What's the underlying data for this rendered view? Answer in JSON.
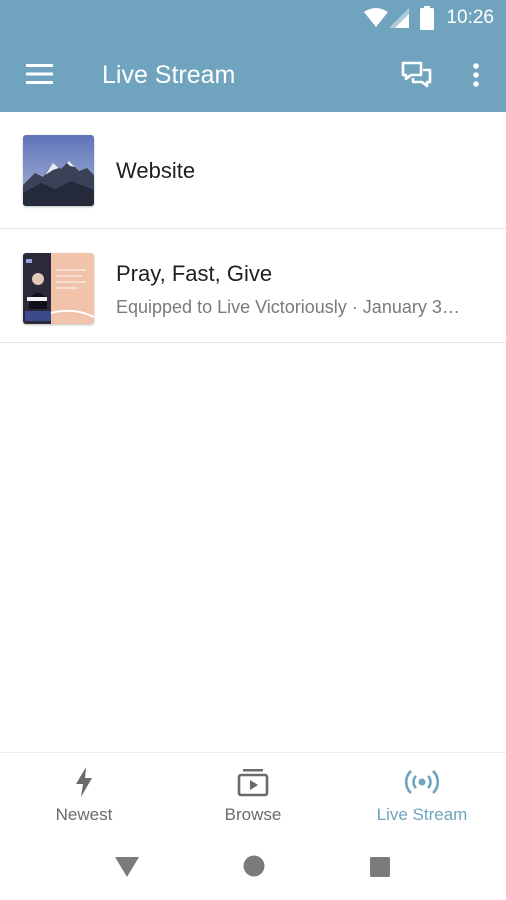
{
  "status_bar": {
    "time": "10:26"
  },
  "toolbar": {
    "title": "Live Stream"
  },
  "items": [
    {
      "title": "Website",
      "subtitle": ""
    },
    {
      "title": "Pray, Fast, Give",
      "subtitle": "Equipped to Live Victoriously · January 3…"
    }
  ],
  "bottom_nav": [
    {
      "label": "Newest",
      "icon": "bolt-icon",
      "active": false
    },
    {
      "label": "Browse",
      "icon": "video-library-icon",
      "active": false
    },
    {
      "label": "Live Stream",
      "icon": "broadcast-icon",
      "active": true
    }
  ],
  "colors": {
    "accent": "#6fa3be",
    "appbar": "#6fa3be"
  }
}
